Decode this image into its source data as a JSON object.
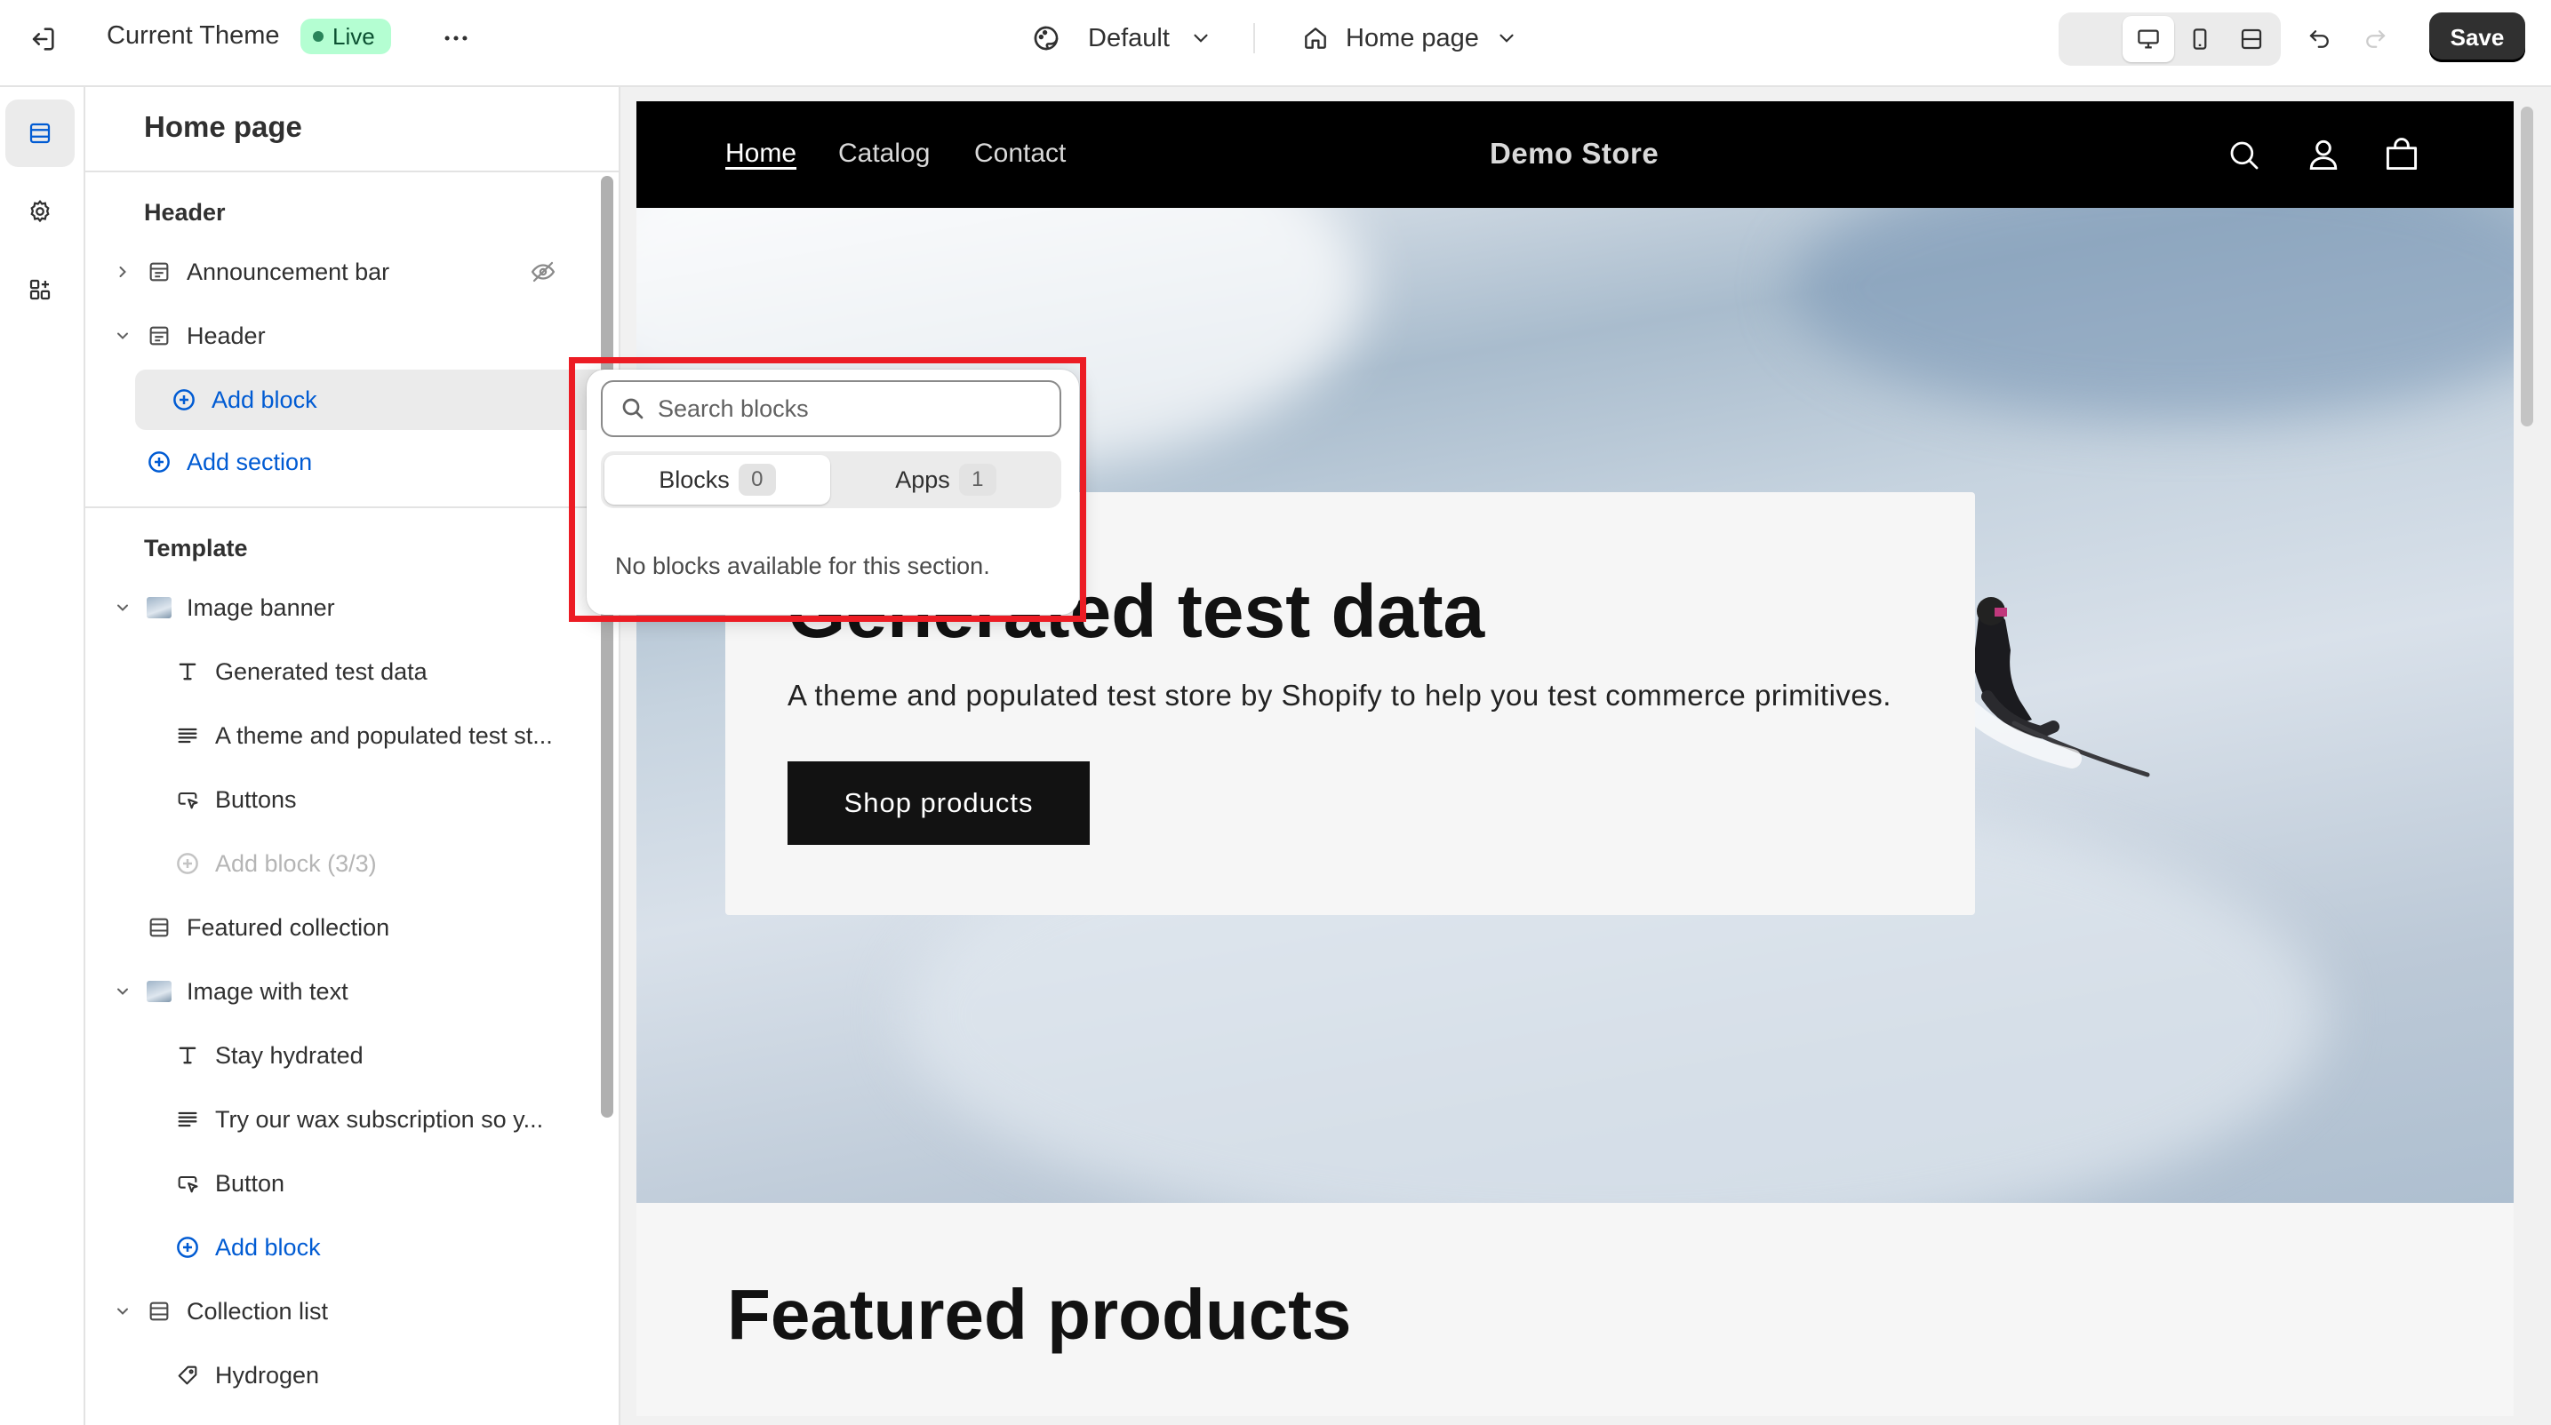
{
  "topbar": {
    "theme_name": "Current Theme",
    "live_badge": "Live",
    "more_icon": "more-horizontal-icon",
    "theme_style": "Default",
    "page_selector": "Home page",
    "save_label": "Save"
  },
  "rail": {
    "items": [
      "sections-icon",
      "settings-icon",
      "apps-icon"
    ]
  },
  "sidebar": {
    "title": "Home page",
    "header_group": "Header",
    "template_group": "Template",
    "items": [
      {
        "label": "Announcement bar",
        "icon": "section-icon",
        "hidden_icon": "eye-hidden-icon"
      },
      {
        "label": "Header",
        "icon": "section-icon"
      },
      {
        "label": "Add block",
        "icon": "plus-circle-icon"
      },
      {
        "label": "Add section",
        "icon": "plus-circle-icon"
      },
      {
        "label": "Image banner",
        "icon": "image-thumbnail-icon"
      },
      {
        "label": "Generated test data",
        "icon": "text-icon"
      },
      {
        "label": "A theme and populated test st...",
        "icon": "paragraph-icon"
      },
      {
        "label": "Buttons",
        "icon": "button-icon"
      },
      {
        "label": "Add block (3/3)",
        "icon": "plus-circle-icon"
      },
      {
        "label": "Featured collection",
        "icon": "section-icon"
      },
      {
        "label": "Image with text",
        "icon": "image-thumbnail-icon"
      },
      {
        "label": "Stay hydrated",
        "icon": "text-icon"
      },
      {
        "label": "Try our wax subscription so y...",
        "icon": "paragraph-icon"
      },
      {
        "label": "Button",
        "icon": "button-icon"
      },
      {
        "label": "Add block",
        "icon": "plus-circle-icon"
      },
      {
        "label": "Collection list",
        "icon": "section-icon"
      },
      {
        "label": "Hydrogen",
        "icon": "collection-icon"
      }
    ]
  },
  "popover": {
    "search_placeholder": "Search blocks",
    "tabs": [
      {
        "label": "Blocks",
        "count": "0"
      },
      {
        "label": "Apps",
        "count": "1"
      }
    ],
    "empty_message": "No blocks available for this section."
  },
  "preview": {
    "nav": [
      "Home",
      "Catalog",
      "Contact"
    ],
    "store_name": "Demo Store",
    "hero_heading": "Generated test data",
    "hero_text": "A theme and populated test store by Shopify to help you test commerce primitives.",
    "hero_button": "Shop products",
    "featured_heading": "Featured products"
  },
  "colors": {
    "accent_blue": "#005bd3",
    "live_badge_bg": "#b4fed2",
    "highlight_red": "#ec1c24",
    "save_button_bg": "#303030"
  }
}
